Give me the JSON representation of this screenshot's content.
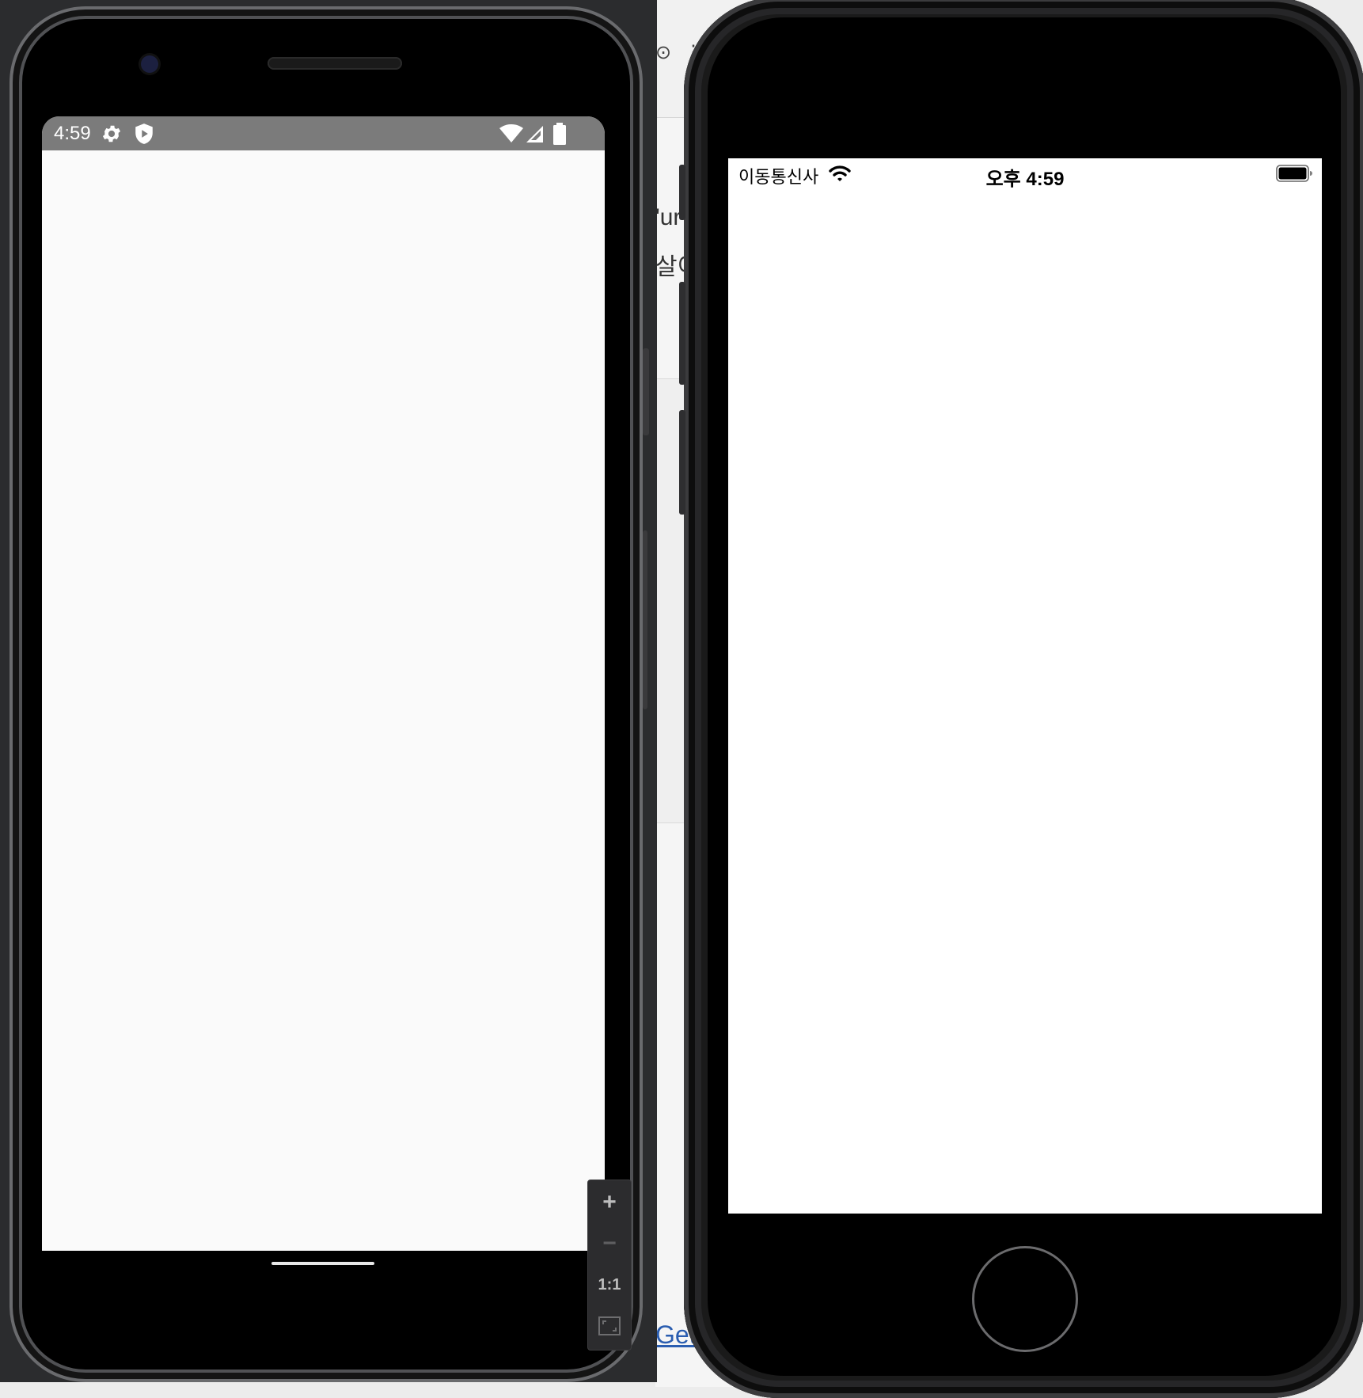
{
  "background_page": {
    "topbar_glyphs": [
      "⊙",
      "⋮"
    ],
    "text_line_1": "'ur",
    "text_line_2": "살이",
    "link_text": "Getti"
  },
  "android": {
    "status_bar": {
      "time": "4:59",
      "icons": [
        "gear-icon",
        "shield-icon",
        "wifi-icon",
        "signal-icon",
        "battery-icon"
      ],
      "background": "#7b7b7b"
    },
    "screen_background": "#fafafa"
  },
  "zoom_controls": {
    "zoom_in": "+",
    "zoom_out": "−",
    "actual_size": "1:1",
    "fit": "fit-screen-icon"
  },
  "ios": {
    "status_bar": {
      "carrier": "이동통신사",
      "time": "오후 4:59",
      "icons": [
        "wifi-icon",
        "battery-icon"
      ]
    },
    "screen_background": "#ffffff"
  }
}
